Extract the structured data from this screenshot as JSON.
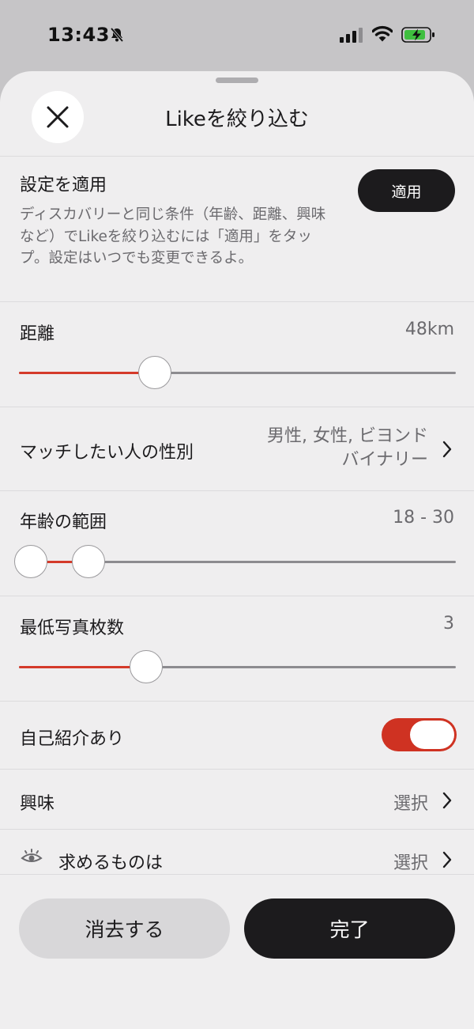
{
  "status_bar": {
    "time": "13:43"
  },
  "sheet": {
    "title": "Likeを絞り込む"
  },
  "apply_settings": {
    "label": "設定を適用",
    "description": "ディスカバリーと同じ条件（年齢、距離、興味など）でLikeを絞り込むには「適用」をタップ。設定はいつでも変更できるよ。",
    "button_label": "適用"
  },
  "distance": {
    "label": "距離",
    "value": "48km",
    "slider_fraction": 0.3
  },
  "gender": {
    "label": "マッチしたい人の性別",
    "value_line1": "男性, 女性, ビヨンド",
    "value_line2": "バイナリー"
  },
  "age_range": {
    "label": "年齢の範囲",
    "value": "18 - 30",
    "min_fraction": 0.0,
    "max_fraction": 0.14
  },
  "min_photos": {
    "label": "最低写真枚数",
    "value": "3",
    "slider_fraction": 0.28
  },
  "has_bio": {
    "label": "自己紹介あり",
    "enabled": true
  },
  "interests": {
    "label": "興味",
    "value": "選択"
  },
  "looking_for": {
    "label": "求めるものは",
    "value": "選択"
  },
  "footer": {
    "clear_label": "消去する",
    "done_label": "完了"
  },
  "colors": {
    "accent": "#d43a2a",
    "toggle_on": "#cf3222",
    "dark": "#1c1b1d",
    "sheet_bg": "#efeeef"
  }
}
